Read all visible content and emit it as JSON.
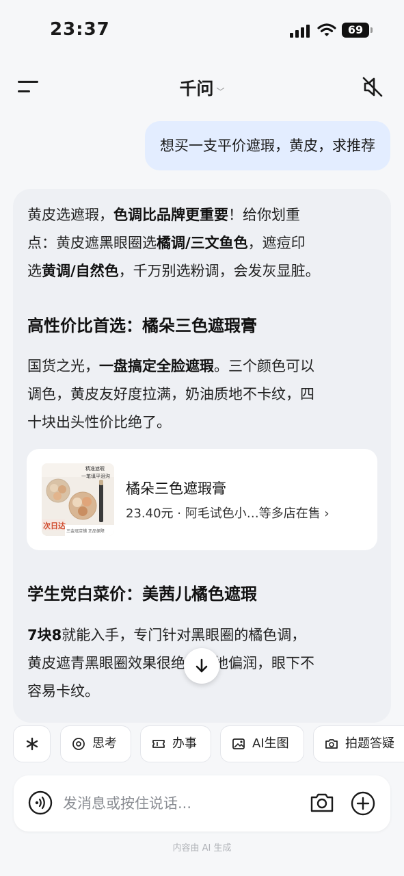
{
  "status_bar": {
    "time": "23:37",
    "battery": "69"
  },
  "header": {
    "title": "千问"
  },
  "conversation": {
    "user_message": "想买一支平价遮瑕，黄皮，求推荐",
    "answer": {
      "intro_line1_a": "黄皮选遮瑕，",
      "intro_line1_b": "色调比品牌更重要",
      "intro_line1_c": "！给你划重",
      "intro_line2_a": "点：黄皮遮黑眼圈选",
      "intro_line2_b": "橘调/三文鱼色",
      "intro_line2_c": "，遮痘印",
      "intro_line3_a": "选",
      "intro_line3_b": "黄调/自然色",
      "intro_line3_c": "，千万别选粉调，会发灰显脏。",
      "section1_heading": "高性价比首选：橘朵三色遮瑕膏",
      "section1_line1_a": "国货之光，",
      "section1_line1_b": "一盘搞定全脸遮瑕",
      "section1_line1_c": "。三个颜色可以",
      "section1_line2": "调色，黄皮友好度拉满，奶油质地不卡纹，四",
      "section1_line3": "十块出头性价比绝了。",
      "product": {
        "name": "橘朵三色遮瑕膏",
        "price_line": "23.40元 · 阿毛试色小…等多店在售 ›",
        "thumb_text_1": "精准遮瑕",
        "thumb_text_2": "一笔填平泪沟",
        "thumb_badge": "次日达",
        "thumb_foot": "三金冠店铺 正品保障"
      },
      "section2_heading": "学生党白菜价：美茜儿橘色遮瑕",
      "section2_line1_a": "7块8",
      "section2_line1_b": "就能入手，专门针对黑眼圈的橘色调，",
      "section2_line2": "黄皮遮青黑眼圈效果很绝。质地偏润，眼下不",
      "section2_line3": "容易卡纹。"
    }
  },
  "chips": [
    {
      "label": "",
      "icon": "sparkle-icon"
    },
    {
      "label": "思考",
      "icon": "think-icon"
    },
    {
      "label": "办事",
      "icon": "ticket-icon"
    },
    {
      "label": "AI生图",
      "icon": "image-icon"
    },
    {
      "label": "拍题答疑",
      "icon": "camera-question-icon"
    }
  ],
  "input": {
    "placeholder": "发消息或按住说话..."
  },
  "footer_note": "内容由 AI 生成"
}
